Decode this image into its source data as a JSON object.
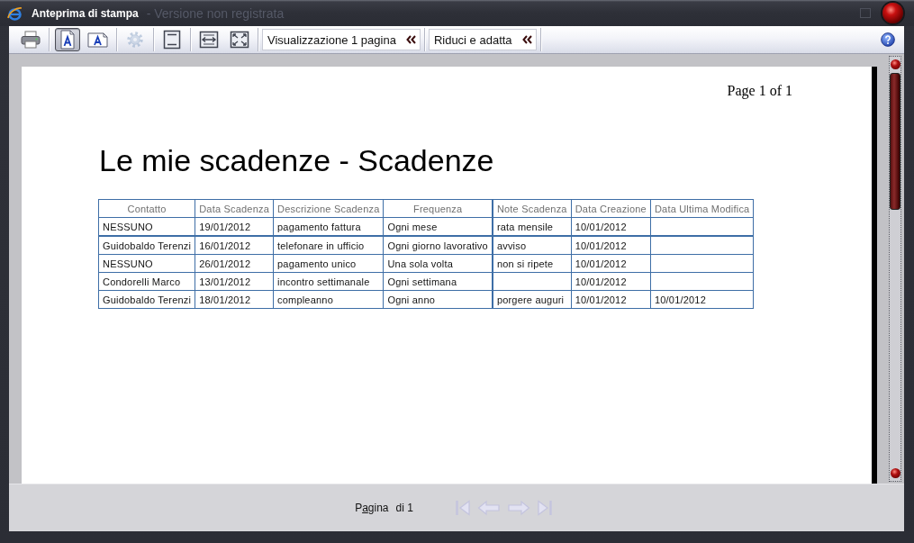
{
  "window": {
    "title": "Anteprima di stampa",
    "background_title": "- Versione non registrata"
  },
  "toolbar": {
    "groups": [
      {
        "buttons": [
          {
            "selected": false,
            "disabled": false
          }
        ]
      },
      {
        "buttons": [
          {
            "selected": true,
            "disabled": false
          },
          {
            "selected": false,
            "disabled": false
          }
        ]
      },
      {
        "buttons": [
          {
            "selected": false,
            "disabled": true
          }
        ]
      },
      {
        "buttons": [
          {
            "selected": false,
            "disabled": false
          }
        ]
      },
      {
        "buttons": [
          {
            "selected": false,
            "disabled": false
          },
          {
            "selected": false,
            "disabled": false
          }
        ]
      }
    ],
    "dropdowns": [
      {
        "value": "Visualizzazione 1 pagina"
      },
      {
        "value": "Riduci e adatta"
      }
    ]
  },
  "page": {
    "header": "Page 1 of 1",
    "title": "Le mie scadenze - Scadenze",
    "table": {
      "columns": [
        "Contatto",
        "Data Scadenza",
        "Descrizione Scadenza",
        "Frequenza",
        "Note Scadenza",
        "Data Creazione",
        "Data Ultima Modifica"
      ],
      "rows": [
        [
          "NESSUNO",
          "19/01/2012",
          "pagamento fattura",
          "Ogni mese",
          "rata mensile",
          "10/01/2012",
          null
        ],
        [
          "Guidobaldo Terenzi",
          "16/01/2012",
          "telefonare in ufficio",
          "Ogni giorno lavorativo",
          "avviso",
          "10/01/2012",
          null
        ],
        [
          "NESSUNO",
          "26/01/2012",
          "pagamento unico",
          "Una sola volta",
          "non si ripete",
          "10/01/2012",
          null
        ],
        [
          "Condorelli Marco",
          "13/01/2012",
          "incontro settimanale",
          "Ogni settimana",
          null,
          "10/01/2012",
          null
        ],
        [
          "Guidobaldo Terenzi",
          "18/01/2012",
          "compleanno",
          "Ogni anno",
          "porgere auguri",
          "10/01/2012",
          "10/01/2012"
        ]
      ]
    }
  },
  "pager": {
    "label_start": "P",
    "label_mnemonic": "a",
    "label_end": "gina",
    "total": "di 1",
    "buttons": [
      {
        "disabled": true
      },
      {
        "disabled": true
      },
      {
        "disabled": true
      },
      {
        "disabled": true
      }
    ]
  }
}
